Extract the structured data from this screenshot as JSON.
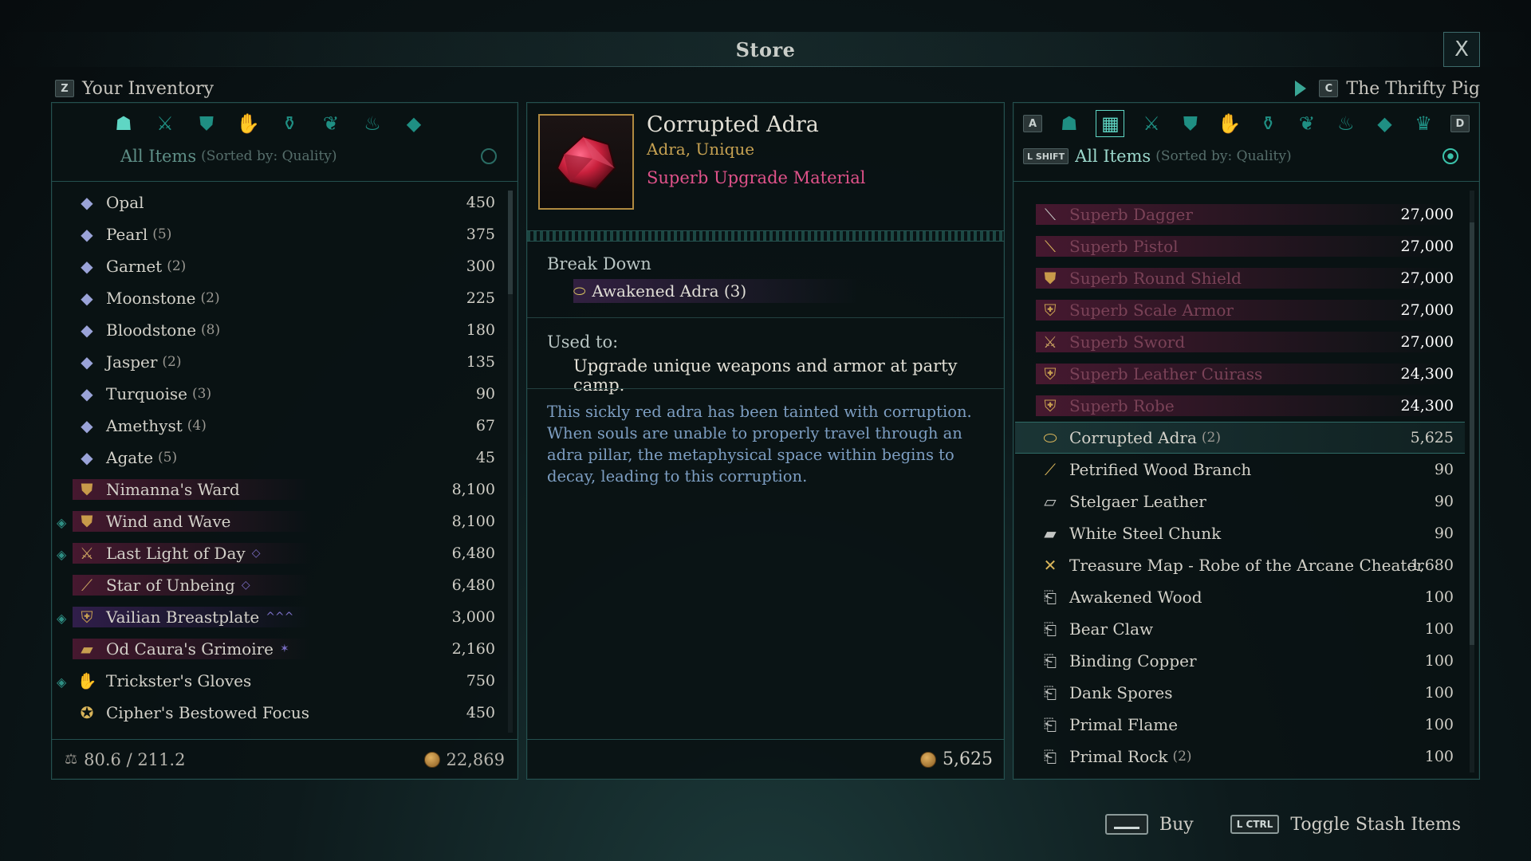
{
  "header": {
    "title": "Store",
    "close_label": "X"
  },
  "inventory": {
    "key": "Z",
    "label": "Your Inventory",
    "sort_label": "All Items",
    "sort_sub": "(Sorted by: Quality)",
    "items": [
      {
        "icon": "gem-icon",
        "name": "Opal",
        "count": "",
        "price": "450",
        "mark": false,
        "glow": ""
      },
      {
        "icon": "gem-icon",
        "name": "Pearl",
        "count": "(5)",
        "price": "375",
        "mark": false,
        "glow": ""
      },
      {
        "icon": "gem-icon",
        "name": "Garnet",
        "count": "(2)",
        "price": "300",
        "mark": false,
        "glow": ""
      },
      {
        "icon": "gem-icon",
        "name": "Moonstone",
        "count": "(2)",
        "price": "225",
        "mark": false,
        "glow": ""
      },
      {
        "icon": "gem-icon",
        "name": "Bloodstone",
        "count": "(8)",
        "price": "180",
        "mark": false,
        "glow": ""
      },
      {
        "icon": "gem-icon",
        "name": "Jasper",
        "count": "(2)",
        "price": "135",
        "mark": false,
        "glow": ""
      },
      {
        "icon": "gem-icon",
        "name": "Turquoise",
        "count": "(3)",
        "price": "90",
        "mark": false,
        "glow": ""
      },
      {
        "icon": "gem-icon",
        "name": "Amethyst",
        "count": "(4)",
        "price": "67",
        "mark": false,
        "glow": ""
      },
      {
        "icon": "gem-icon",
        "name": "Agate",
        "count": "(5)",
        "price": "45",
        "mark": false,
        "glow": ""
      },
      {
        "icon": "shield-icon",
        "name": "Nimanna's Ward",
        "count": "",
        "price": "8,100",
        "mark": false,
        "glow": "red"
      },
      {
        "icon": "shield-icon",
        "name": "Wind and Wave",
        "count": "",
        "price": "8,100",
        "mark": true,
        "glow": "red"
      },
      {
        "icon": "sword-icon",
        "name": "Last Light of Day",
        "count": "",
        "price": "6,480",
        "mark": true,
        "glow": "red",
        "tag": "◇"
      },
      {
        "icon": "staff-icon",
        "name": "Star of Unbeing",
        "count": "",
        "price": "6,480",
        "mark": false,
        "glow": "red",
        "tag": "◇"
      },
      {
        "icon": "armor-icon",
        "name": "Vailian Breastplate",
        "count": "",
        "price": "3,000",
        "mark": true,
        "glow": "purple",
        "tag": "^^^"
      },
      {
        "icon": "grimoire-icon",
        "name": "Od Caura's Grimoire",
        "count": "",
        "price": "2,160",
        "mark": false,
        "glow": "red",
        "tag": "✶"
      },
      {
        "icon": "gloves-icon",
        "name": "Trickster's Gloves",
        "count": "",
        "price": "750",
        "mark": true,
        "glow": ""
      },
      {
        "icon": "focus-icon",
        "name": "Cipher's Bestowed Focus",
        "count": "",
        "price": "450",
        "mark": false,
        "glow": ""
      }
    ],
    "weight": "80.6 / 211.2",
    "gold": "22,869"
  },
  "detail": {
    "name": "Corrupted Adra",
    "type": "Adra, Unique",
    "quality": "Superb Upgrade Material",
    "breakdown_label": "Break Down",
    "breakdown_item": "Awakened Adra (3)",
    "used_label": "Used to:",
    "used_text": "Upgrade unique weapons and armor at party camp.",
    "description": "This sickly red adra has been tainted with corruption. When souls are unable to properly travel through an adra pillar, the metaphysical space within begins to decay, leading to this corruption.",
    "price": "5,625"
  },
  "vendor": {
    "key": "C",
    "name": "The Thrifty Pig",
    "left_key": "A",
    "right_key": "D",
    "shift_key": "L SHIFT",
    "sort_label": "All Items",
    "sort_sub": "(Sorted by: Quality)",
    "items": [
      {
        "icon": "dagger-icon",
        "name": "Superb Dagger",
        "count": "",
        "price": "27,000",
        "locked": true,
        "sel": false
      },
      {
        "icon": "pistol-icon",
        "name": "Superb Pistol",
        "count": "",
        "price": "27,000",
        "locked": true,
        "sel": false
      },
      {
        "icon": "shield-icon",
        "name": "Superb Round Shield",
        "count": "",
        "price": "27,000",
        "locked": true,
        "sel": false
      },
      {
        "icon": "armor-icon",
        "name": "Superb Scale Armor",
        "count": "",
        "price": "27,000",
        "locked": true,
        "sel": false
      },
      {
        "icon": "sword-icon",
        "name": "Superb Sword",
        "count": "",
        "price": "27,000",
        "locked": true,
        "sel": false
      },
      {
        "icon": "cuirass-icon",
        "name": "Superb Leather Cuirass",
        "count": "",
        "price": "24,300",
        "locked": true,
        "sel": false
      },
      {
        "icon": "robe-icon",
        "name": "Superb Robe",
        "count": "",
        "price": "24,300",
        "locked": true,
        "sel": false
      },
      {
        "icon": "adra-icon",
        "name": "Corrupted Adra",
        "count": "(2)",
        "price": "5,625",
        "locked": false,
        "sel": true
      },
      {
        "icon": "branch-icon",
        "name": "Petrified Wood Branch",
        "count": "",
        "price": "90",
        "locked": false,
        "sel": false
      },
      {
        "icon": "leather-icon",
        "name": "Stelgaer Leather",
        "count": "",
        "price": "90",
        "locked": false,
        "sel": false
      },
      {
        "icon": "ingot-icon",
        "name": "White Steel Chunk",
        "count": "",
        "price": "90",
        "locked": false,
        "sel": false
      },
      {
        "icon": "map-icon",
        "name": "Treasure Map - Robe of the Arcane Cheater",
        "count": "",
        "price": "1,680",
        "locked": false,
        "sel": false
      },
      {
        "icon": "scroll-icon",
        "name": "Awakened Wood",
        "count": "",
        "price": "100",
        "locked": false,
        "sel": false
      },
      {
        "icon": "scroll-icon",
        "name": "Bear Claw",
        "count": "",
        "price": "100",
        "locked": false,
        "sel": false
      },
      {
        "icon": "scroll-icon",
        "name": "Binding Copper",
        "count": "",
        "price": "100",
        "locked": false,
        "sel": false
      },
      {
        "icon": "scroll-icon",
        "name": "Dank Spores",
        "count": "",
        "price": "100",
        "locked": false,
        "sel": false
      },
      {
        "icon": "scroll-icon",
        "name": "Primal Flame",
        "count": "",
        "price": "100",
        "locked": false,
        "sel": false
      },
      {
        "icon": "scroll-icon",
        "name": "Primal Rock",
        "count": "(2)",
        "price": "100",
        "locked": false,
        "sel": false
      }
    ]
  },
  "hints": {
    "buy": "Buy",
    "ctrl_key": "L CTRL",
    "toggle": "Toggle Stash Items"
  }
}
